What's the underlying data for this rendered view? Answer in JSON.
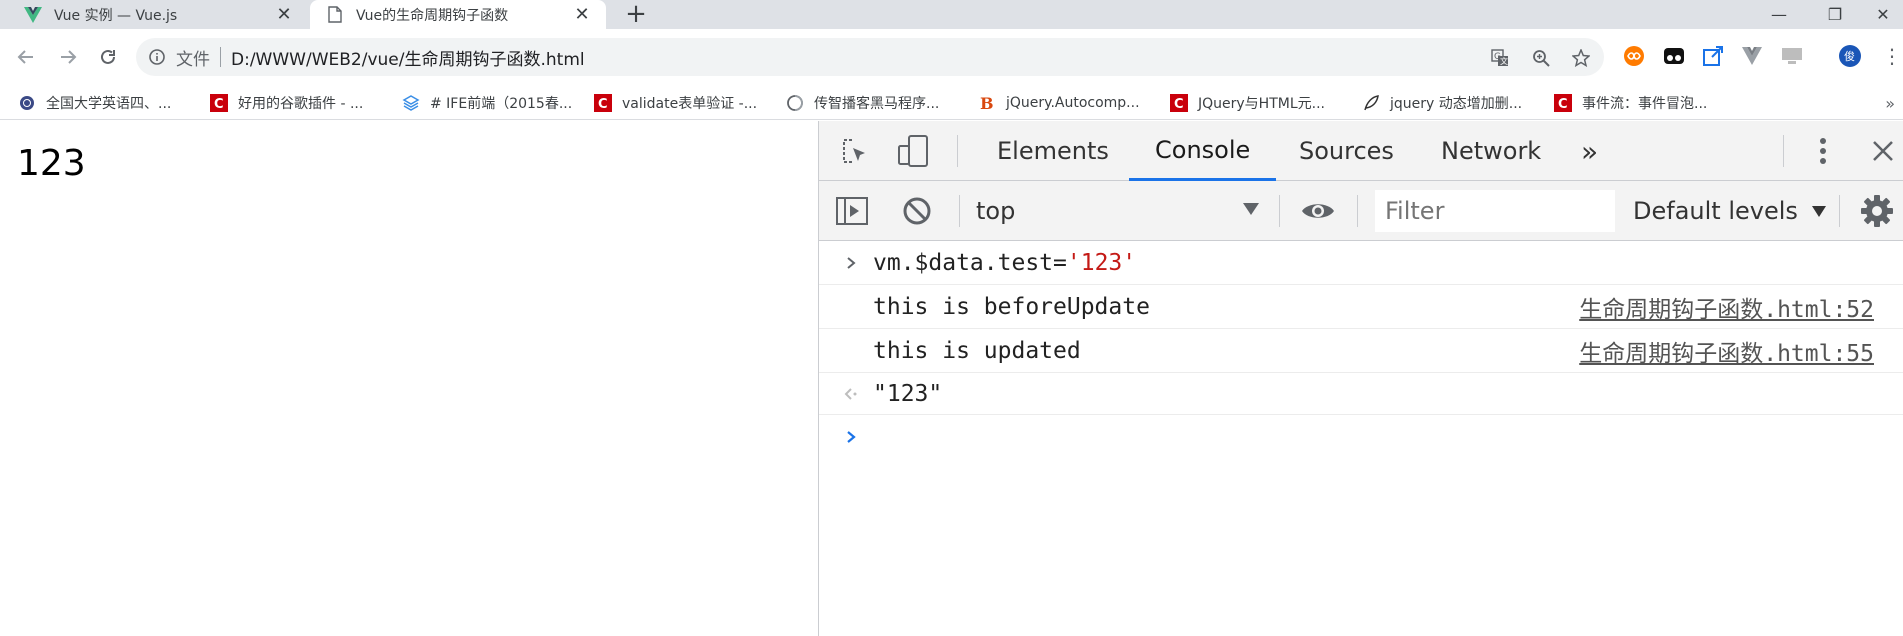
{
  "tabs": [
    {
      "title": "Vue 实例 — Vue.js",
      "icon": "vue-logo-icon"
    },
    {
      "title": "Vue的生命周期钩子函数",
      "icon": "document-icon"
    }
  ],
  "window": {
    "minimize": "—",
    "restore": "❐",
    "close": "✕"
  },
  "address": {
    "scheme_label": "文件",
    "url": "D:/WWW/WEB2/vue/生命周期钩子函数.html"
  },
  "bookmarks": [
    {
      "label": "全国大学英语四、...",
      "icon": "globe-icon"
    },
    {
      "label": "好用的谷歌插件 - ...",
      "icon": "csdn-icon"
    },
    {
      "label": "# IFE前端（2015春...",
      "icon": "layers-icon"
    },
    {
      "label": "validate表单验证 -...",
      "icon": "csdn-icon"
    },
    {
      "label": "传智播客黑马程序...",
      "icon": "circle-icon"
    },
    {
      "label": "jQuery.Autocomp...",
      "icon": "bootstrap-icon"
    },
    {
      "label": "JQuery与HTML元...",
      "icon": "csdn-icon"
    },
    {
      "label": "jquery 动态增加删...",
      "icon": "leaf-icon"
    },
    {
      "label": "事件流：事件冒泡...",
      "icon": "csdn-icon"
    }
  ],
  "page": {
    "text": "123"
  },
  "devtools": {
    "tabs": [
      "Elements",
      "Console",
      "Sources",
      "Network"
    ],
    "active_tab": "Console",
    "more_tabs": "»",
    "context": "top",
    "filter_placeholder": "Filter",
    "levels": "Default levels",
    "console": {
      "input_expr": "vm.$data.test=",
      "input_value": "'123'",
      "logs": [
        {
          "text": "this is beforeUpdate",
          "source": "生命周期钩子函数.html:52"
        },
        {
          "text": "this is updated",
          "source": "生命周期钩子函数.html:55"
        }
      ],
      "result": "\"123\""
    }
  },
  "colors": {
    "accent": "#1a73e8",
    "string": "#c41a16",
    "tab_strip": "#dee1e6"
  }
}
